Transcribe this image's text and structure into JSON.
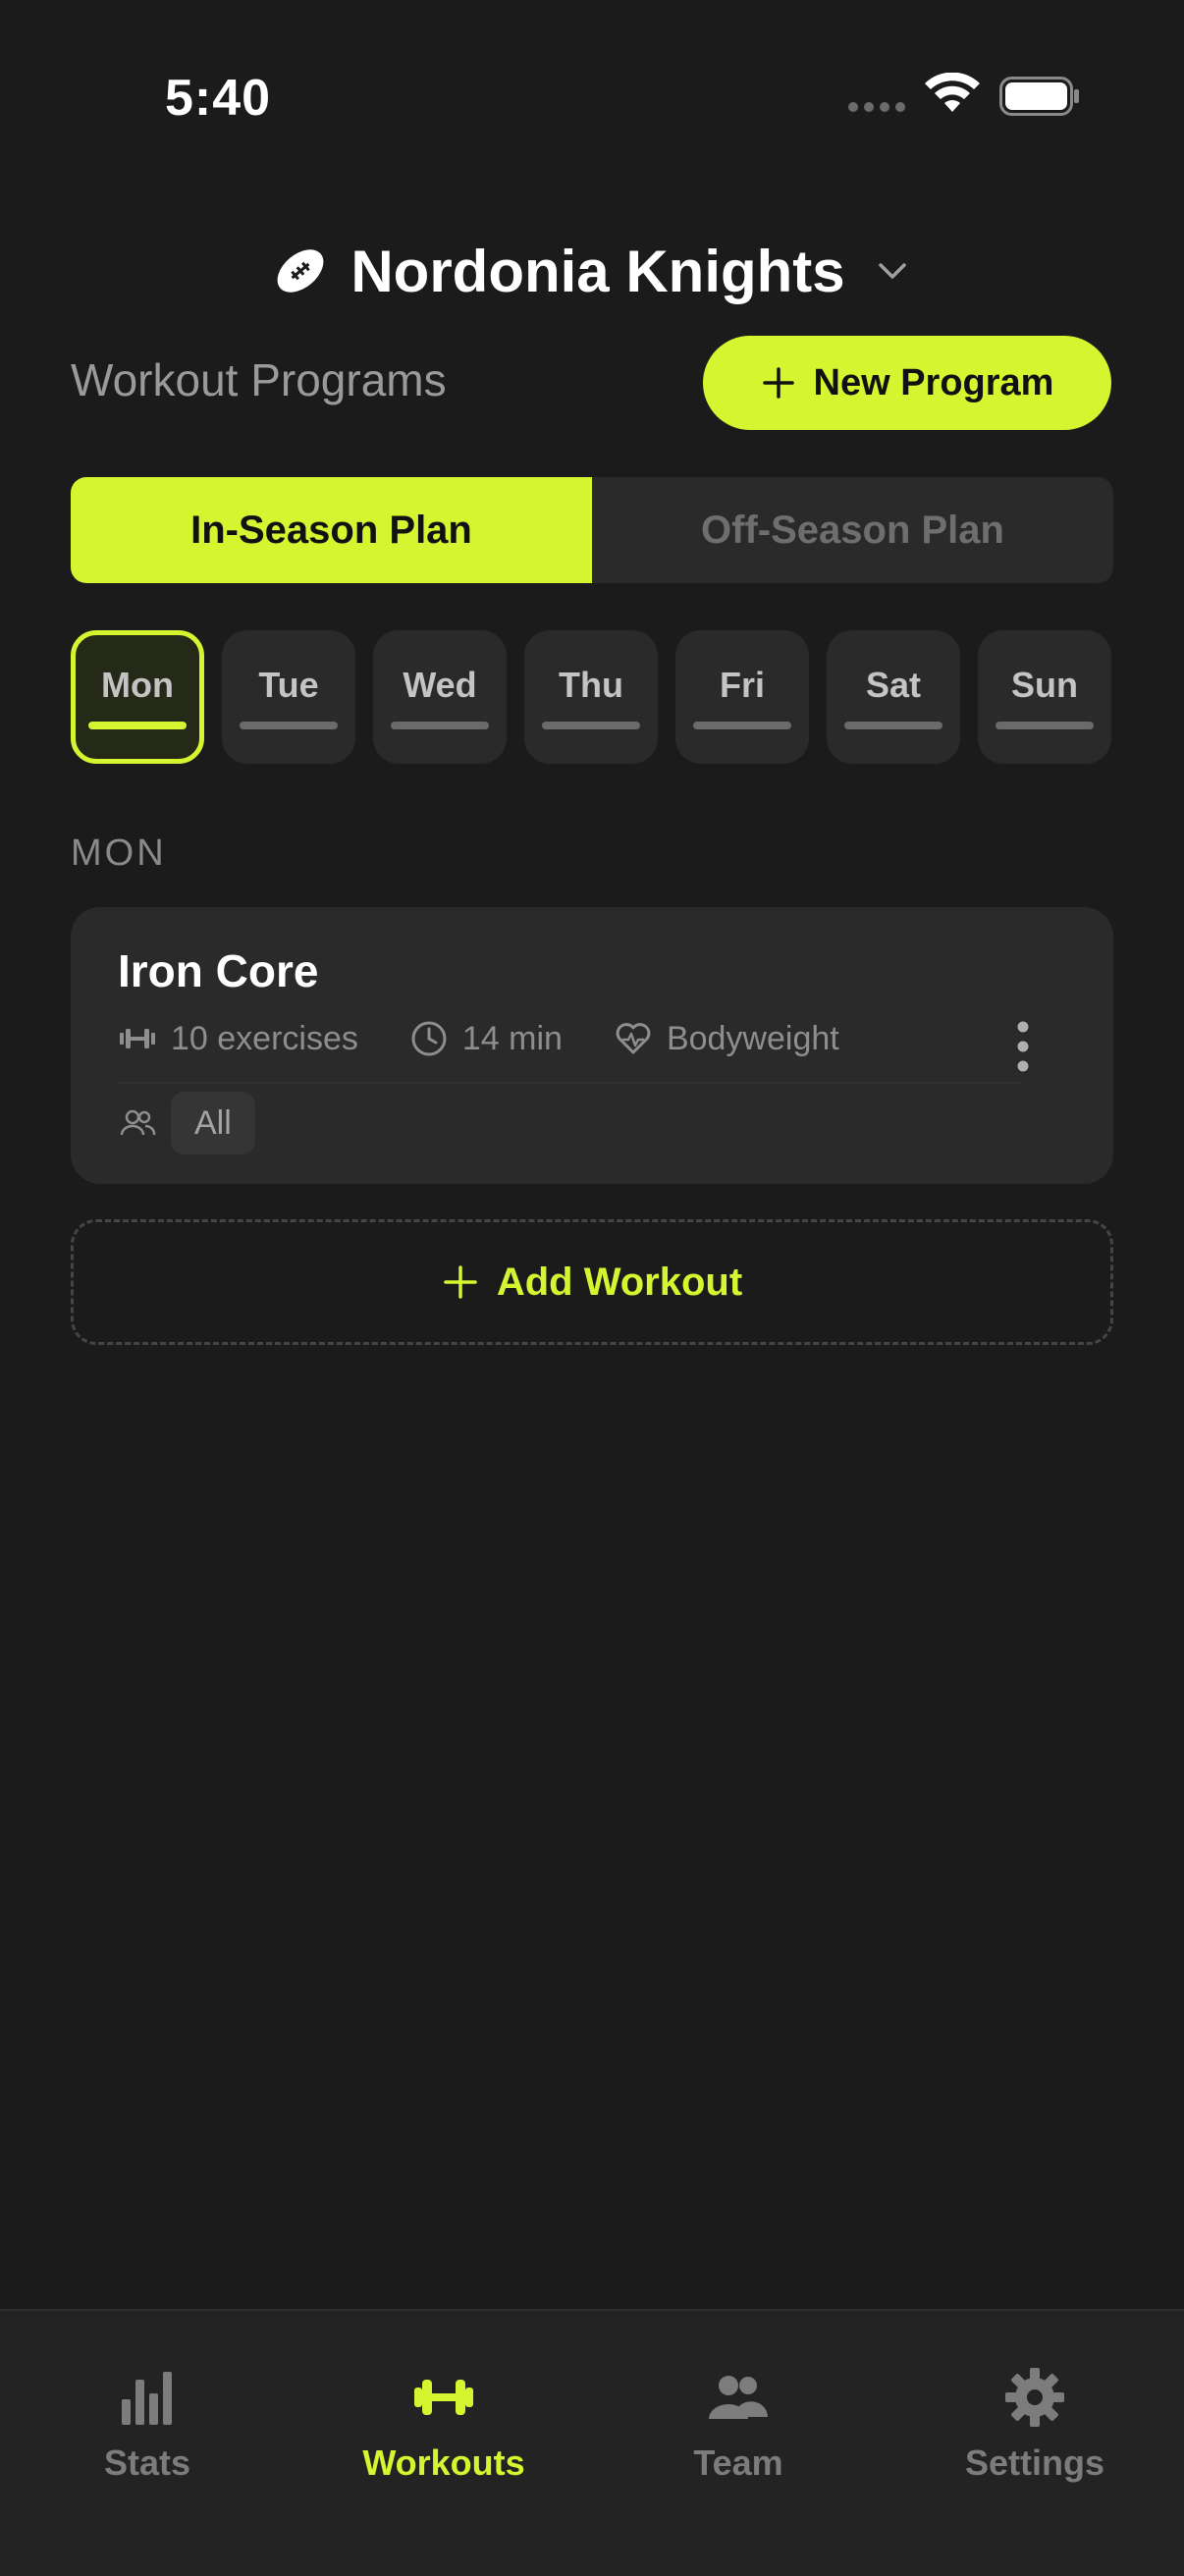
{
  "status_bar": {
    "time": "5:40"
  },
  "header": {
    "team_name": "Nordonia Knights"
  },
  "programs": {
    "title": "Workout Programs",
    "new_program_label": "New Program"
  },
  "plans": {
    "tabs": [
      {
        "label": "In-Season Plan",
        "active": true
      },
      {
        "label": "Off-Season Plan",
        "active": false
      }
    ]
  },
  "days": [
    {
      "label": "Mon",
      "active": true
    },
    {
      "label": "Tue",
      "active": false
    },
    {
      "label": "Wed",
      "active": false
    },
    {
      "label": "Thu",
      "active": false
    },
    {
      "label": "Fri",
      "active": false
    },
    {
      "label": "Sat",
      "active": false
    },
    {
      "label": "Sun",
      "active": false
    }
  ],
  "selected_day_heading": "MON",
  "workouts": [
    {
      "title": "Iron Core",
      "exercises": "10 exercises",
      "duration": "14 min",
      "equipment": "Bodyweight",
      "group": "All"
    }
  ],
  "add_workout_label": "Add Workout",
  "tabbar": {
    "items": [
      {
        "label": "Stats",
        "icon": "chart-icon",
        "active": false
      },
      {
        "label": "Workouts",
        "icon": "dumbbell-icon",
        "active": true
      },
      {
        "label": "Team",
        "icon": "people-icon",
        "active": false
      },
      {
        "label": "Settings",
        "icon": "gear-icon",
        "active": false
      }
    ]
  },
  "colors": {
    "accent": "#d4f52f",
    "background": "#1b1b1b",
    "surface": "#2a2a2a"
  }
}
